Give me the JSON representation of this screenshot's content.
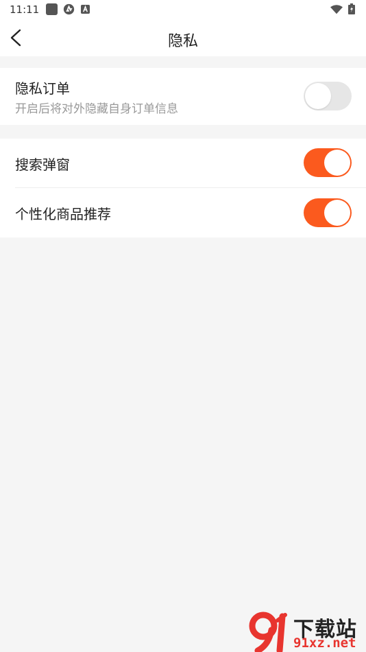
{
  "status_bar": {
    "time": "11:11",
    "icons": [
      "square-app-icon",
      "aperture-icon",
      "font-a-icon",
      "wifi-icon",
      "battery-icon"
    ]
  },
  "header": {
    "title": "隐私",
    "back_icon": "chevron-left-icon"
  },
  "sections": [
    {
      "items": [
        {
          "title": "隐私订单",
          "subtitle": "开启后将对外隐藏自身订单信息",
          "enabled": false
        }
      ]
    },
    {
      "items": [
        {
          "title": "搜索弹窗",
          "enabled": true
        },
        {
          "title": "个性化商品推荐",
          "enabled": true
        }
      ]
    }
  ],
  "colors": {
    "accent": "#fb5a1e",
    "toggle_off": "#e6e6e6",
    "background": "#f5f5f5",
    "watermark_red": "#e8352f"
  },
  "watermark": {
    "site_name": "下载站",
    "url": "91xz.net"
  }
}
